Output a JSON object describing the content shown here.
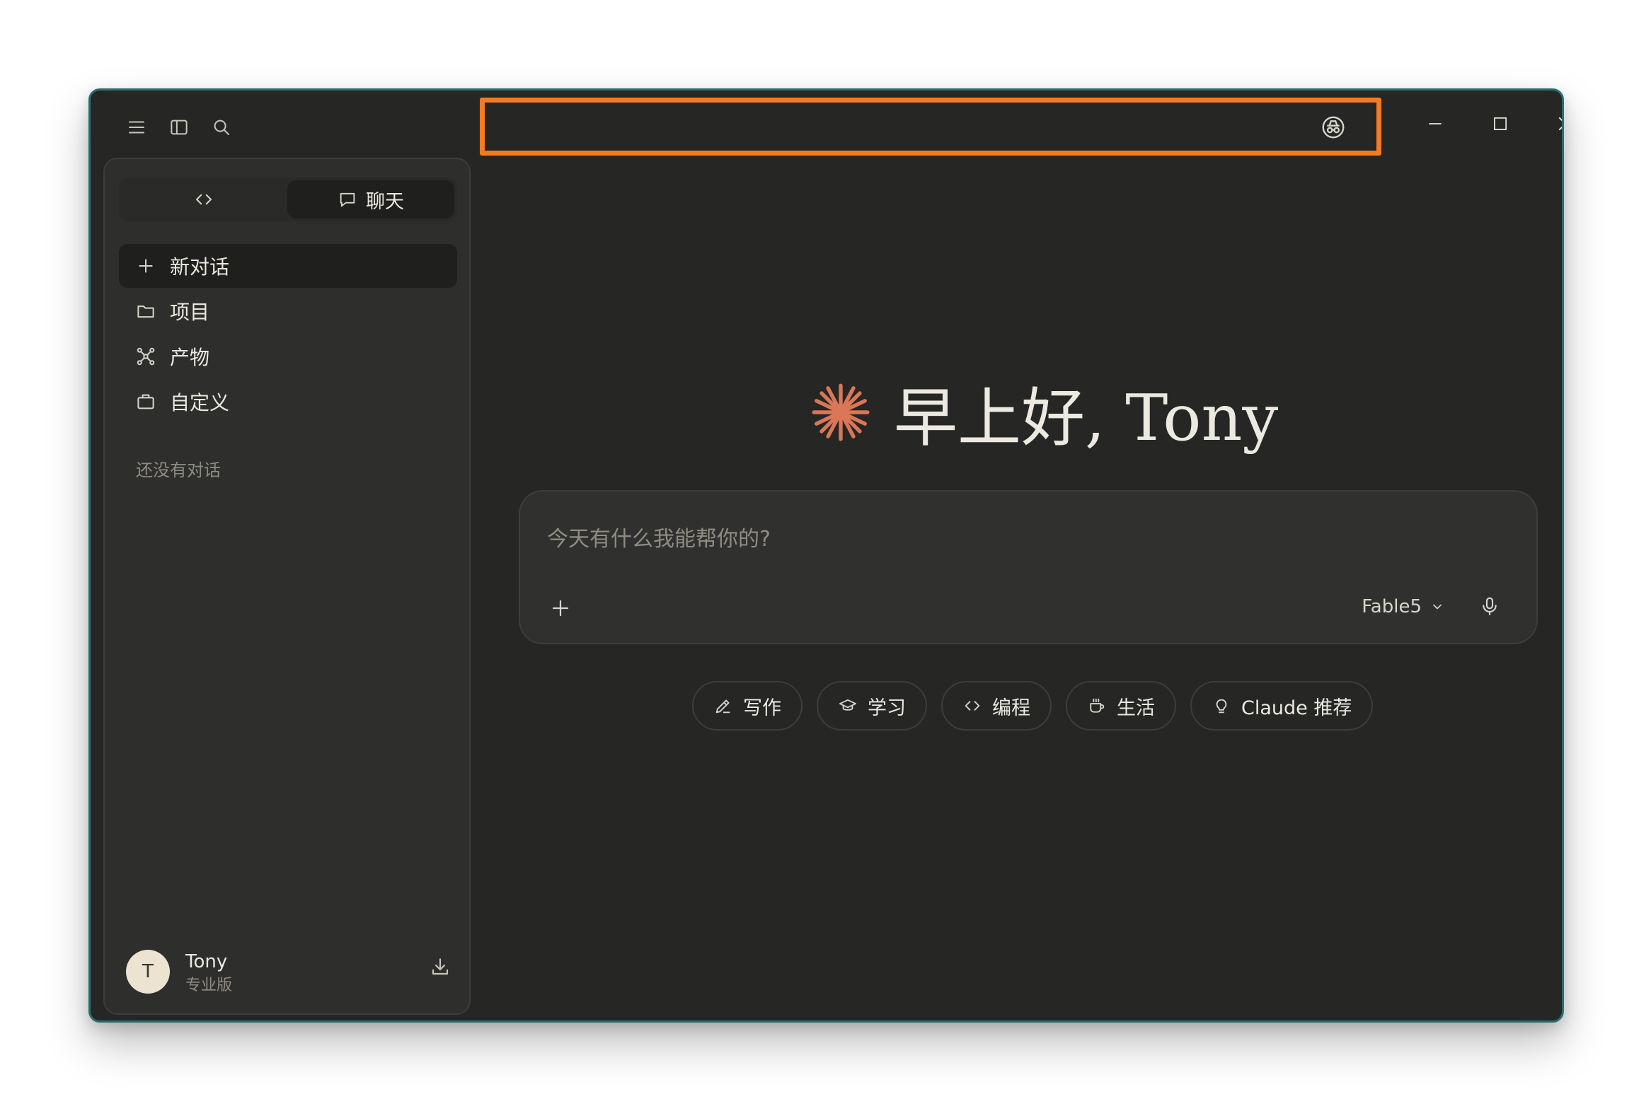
{
  "titlebar": {
    "menu_icon": "hamburger-menu-icon",
    "sidebar_toggle_icon": "sidebar-toggle-icon",
    "search_icon": "search-icon",
    "incognito_icon": "incognito-icon"
  },
  "window_controls": {
    "minimize_icon": "minimize-icon",
    "maximize_icon": "maximize-icon",
    "close_icon": "close-icon"
  },
  "mode_toggle": {
    "code_icon": "code-icon",
    "chat_label": "聊天",
    "chat_icon": "chat-bubble-icon"
  },
  "sidebar": {
    "items": [
      {
        "label": "新对话",
        "icon": "plus-icon"
      },
      {
        "label": "项目",
        "icon": "folder-icon"
      },
      {
        "label": "产物",
        "icon": "artifacts-icon"
      },
      {
        "label": "自定义",
        "icon": "briefcase-icon"
      }
    ],
    "empty_note": "还没有对话"
  },
  "user": {
    "initial": "T",
    "name": "Tony",
    "plan": "专业版",
    "download_icon": "download-icon"
  },
  "greeting": {
    "text": "早上好, Tony",
    "icon": "claude-spark-icon"
  },
  "composer": {
    "placeholder": "今天有什么我能帮你的?",
    "attach_icon": "plus-icon",
    "model": "Fable5",
    "mic_icon": "microphone-icon"
  },
  "chips": [
    {
      "label": "写作",
      "icon": "pen-icon"
    },
    {
      "label": "学习",
      "icon": "graduation-cap-icon"
    },
    {
      "label": "编程",
      "icon": "code-icon"
    },
    {
      "label": "生活",
      "icon": "coffee-cup-icon"
    },
    {
      "label": "Claude 推荐",
      "icon": "lightbulb-icon"
    }
  ],
  "colors": {
    "background": "#262624",
    "accent": "#d97757",
    "highlight_border": "#f47b20"
  }
}
